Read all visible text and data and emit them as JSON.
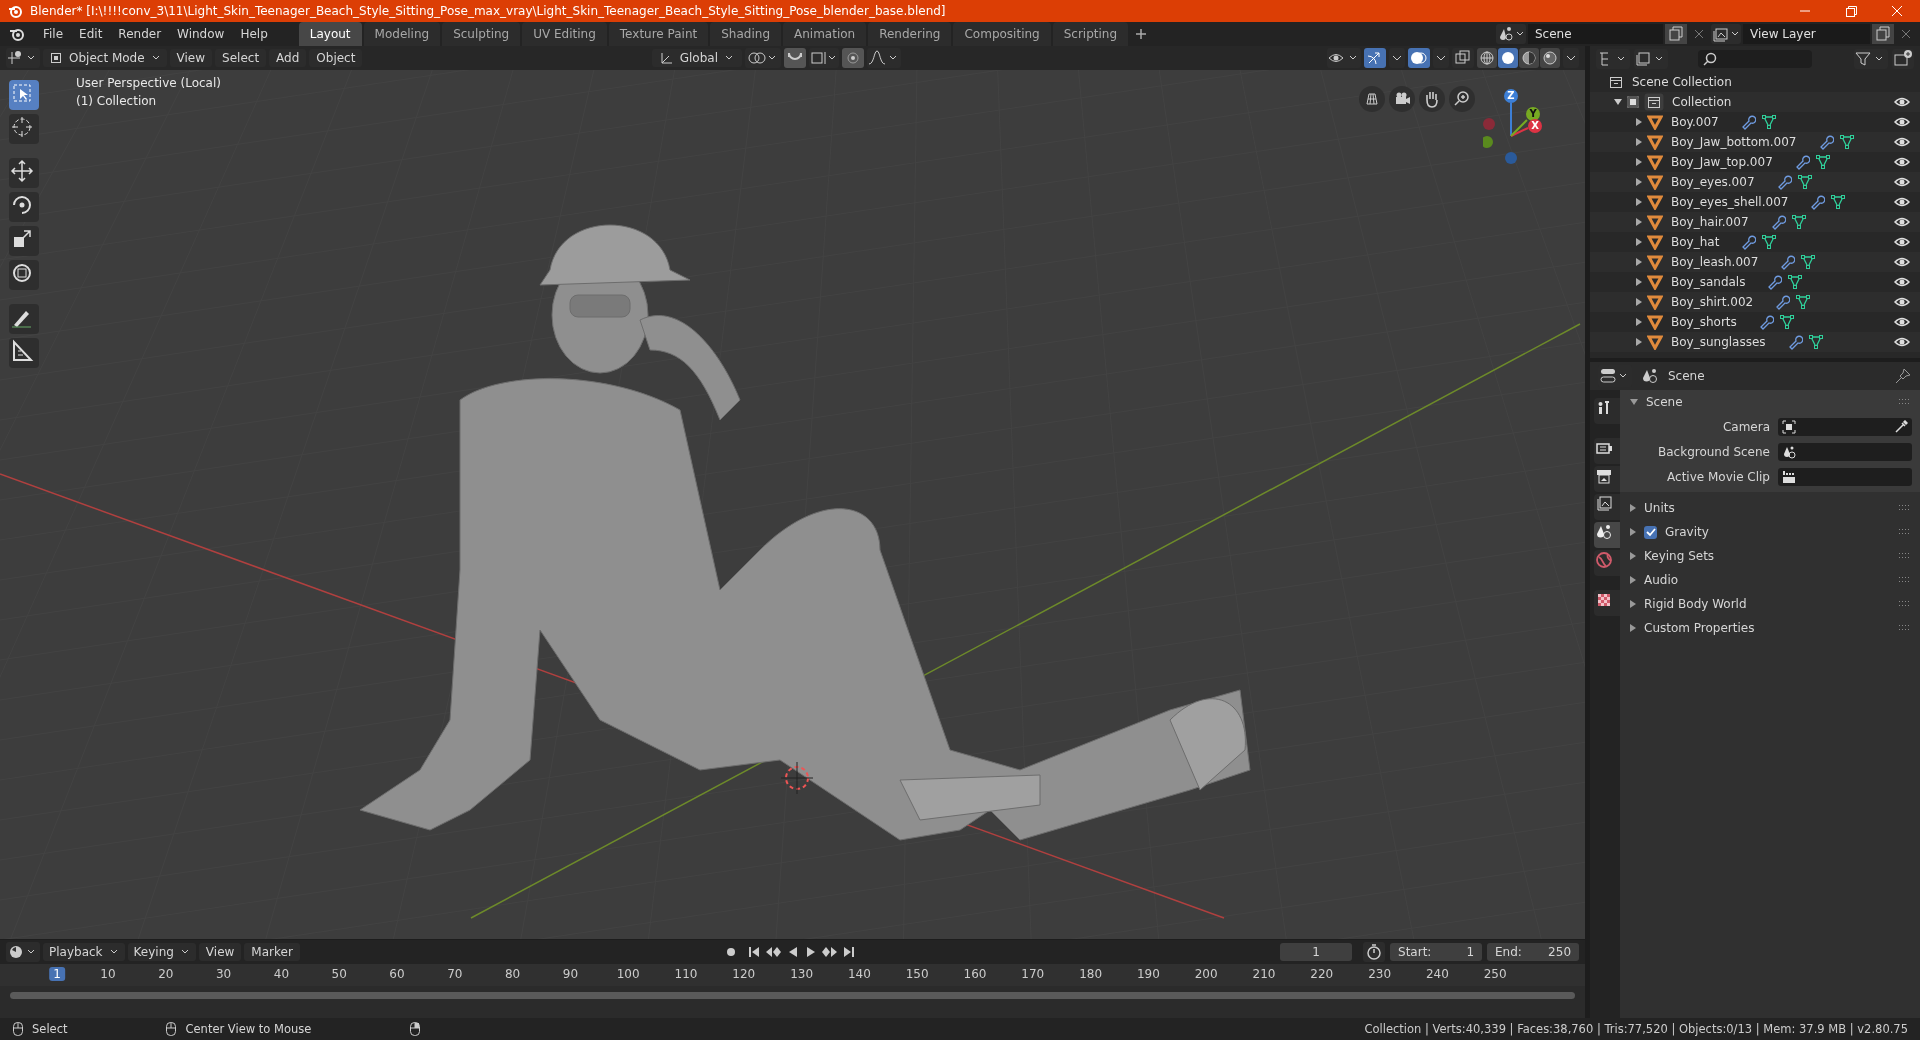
{
  "window": {
    "title": "Blender* [I:\\!!!!conv_3\\11\\Light_Skin_Teenager_Beach_Style_Sitting_Pose_max_vray\\Light_Skin_Teenager_Beach_Style_Sitting_Pose_blender_base.blend]"
  },
  "menu": [
    "File",
    "Edit",
    "Render",
    "Window",
    "Help"
  ],
  "workspaces": [
    {
      "label": "Layout",
      "selected": true
    },
    {
      "label": "Modeling",
      "selected": false
    },
    {
      "label": "Sculpting",
      "selected": false
    },
    {
      "label": "UV Editing",
      "selected": false
    },
    {
      "label": "Texture Paint",
      "selected": false
    },
    {
      "label": "Shading",
      "selected": false
    },
    {
      "label": "Animation",
      "selected": false
    },
    {
      "label": "Rendering",
      "selected": false
    },
    {
      "label": "Compositing",
      "selected": false
    },
    {
      "label": "Scripting",
      "selected": false
    }
  ],
  "scene": "Scene",
  "view_layer": "View Layer",
  "viewport_header": {
    "mode": "Object Mode",
    "menus": [
      "View",
      "Select",
      "Add",
      "Object"
    ],
    "orientation": "Global",
    "shading": [
      {
        "kind": "wireframe",
        "selected": false
      },
      {
        "kind": "solid",
        "selected": true
      },
      {
        "kind": "material",
        "selected": false
      },
      {
        "kind": "rendered",
        "selected": false
      }
    ]
  },
  "tools": [
    {
      "kind": "select",
      "selected": true
    },
    {
      "kind": "cursor",
      "selected": false
    },
    {
      "kind": "move",
      "selected": false
    },
    {
      "kind": "rotate",
      "selected": false
    },
    {
      "kind": "scale",
      "selected": false
    },
    {
      "kind": "transform",
      "selected": false
    },
    {
      "kind": "annotate",
      "selected": false
    },
    {
      "kind": "measure",
      "selected": false
    }
  ],
  "viewport_info": [
    "User Perspective (Local)",
    "(1) Collection"
  ],
  "gizmo": [
    "Z",
    "Y",
    "X"
  ],
  "outliner": {
    "scene_collection": "Scene Collection",
    "collection": {
      "name": "Collection",
      "checked": true,
      "expanded": true,
      "children": [
        {
          "name": "Boy.007",
          "expanded": false
        },
        {
          "name": "Boy_Jaw_bottom.007",
          "expanded": false
        },
        {
          "name": "Boy_Jaw_top.007",
          "expanded": false
        },
        {
          "name": "Boy_eyes.007",
          "expanded": false
        },
        {
          "name": "Boy_eyes_shell.007",
          "expanded": false
        },
        {
          "name": "Boy_hair.007",
          "expanded": false
        },
        {
          "name": "Boy_hat",
          "expanded": false
        },
        {
          "name": "Boy_leash.007",
          "expanded": false
        },
        {
          "name": "Boy_sandals",
          "expanded": false
        },
        {
          "name": "Boy_shirt.002",
          "expanded": false
        },
        {
          "name": "Boy_shorts",
          "expanded": false
        },
        {
          "name": "Boy_sunglasses",
          "expanded": false
        }
      ]
    }
  },
  "properties": {
    "context": "Scene",
    "tabs": [
      {
        "kind": "tool",
        "selected": false
      },
      {
        "kind": "render",
        "selected": false
      },
      {
        "kind": "output",
        "selected": false
      },
      {
        "kind": "view_layer",
        "selected": false
      },
      {
        "kind": "scene",
        "selected": true
      },
      {
        "kind": "world",
        "selected": false
      },
      {
        "kind": "texture",
        "selected": false
      }
    ],
    "panels": [
      {
        "title": "Scene",
        "expanded": true,
        "fields": [
          {
            "label": "Camera",
            "kind": "camera"
          },
          {
            "label": "Background Scene",
            "kind": "scene"
          },
          {
            "label": "Active Movie Clip",
            "kind": "clip"
          }
        ]
      },
      {
        "title": "Units",
        "expanded": false
      },
      {
        "title": "Gravity",
        "expanded": false,
        "checked": true
      },
      {
        "title": "Keying Sets",
        "expanded": false
      },
      {
        "title": "Audio",
        "expanded": false
      },
      {
        "title": "Rigid Body World",
        "expanded": false
      },
      {
        "title": "Custom Properties",
        "expanded": false
      }
    ]
  },
  "timeline": {
    "menus": [
      "Playback",
      "Keying",
      "View",
      "Marker"
    ],
    "current_frame": "1",
    "start_label": "Start:",
    "start": "1",
    "end_label": "End:",
    "end": "250",
    "ticks": [
      {
        "label": "1",
        "selected": true
      },
      {
        "label": "10",
        "selected": false
      },
      {
        "label": "20",
        "selected": false
      },
      {
        "label": "30",
        "selected": false
      },
      {
        "label": "40",
        "selected": false
      },
      {
        "label": "50",
        "selected": false
      },
      {
        "label": "60",
        "selected": false
      },
      {
        "label": "70",
        "selected": false
      },
      {
        "label": "80",
        "selected": false
      },
      {
        "label": "90",
        "selected": false
      },
      {
        "label": "100",
        "selected": false
      },
      {
        "label": "110",
        "selected": false
      },
      {
        "label": "120",
        "selected": false
      },
      {
        "label": "130",
        "selected": false
      },
      {
        "label": "140",
        "selected": false
      },
      {
        "label": "150",
        "selected": false
      },
      {
        "label": "160",
        "selected": false
      },
      {
        "label": "170",
        "selected": false
      },
      {
        "label": "180",
        "selected": false
      },
      {
        "label": "190",
        "selected": false
      },
      {
        "label": "200",
        "selected": false
      },
      {
        "label": "210",
        "selected": false
      },
      {
        "label": "220",
        "selected": false
      },
      {
        "label": "230",
        "selected": false
      },
      {
        "label": "240",
        "selected": false
      },
      {
        "label": "250",
        "selected": false
      }
    ]
  },
  "status_bar": {
    "hints": [
      "Select",
      "Center View to Mouse"
    ],
    "stats": "Collection | Verts:40,339 | Faces:38,760 | Tris:77,520 | Objects:0/13 | Mem: 37.9 MB | v2.80.75"
  }
}
